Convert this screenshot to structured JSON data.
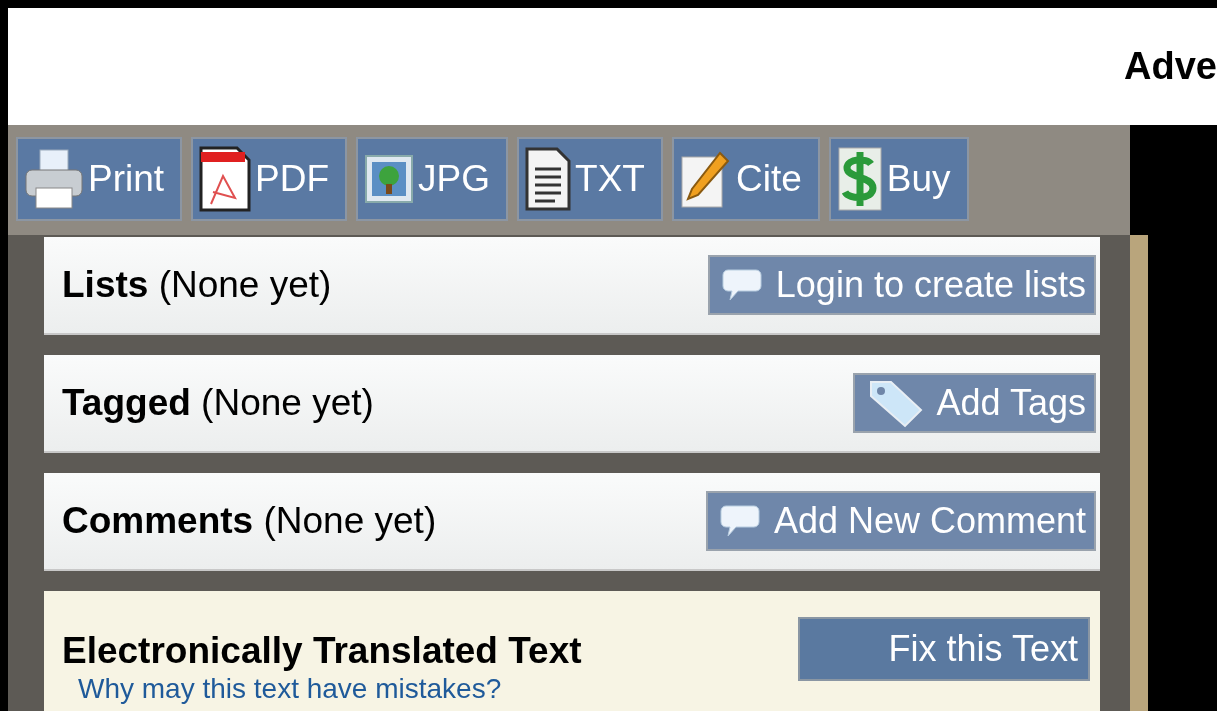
{
  "header": {
    "text": "Adve"
  },
  "toolbar": [
    {
      "label": "Print",
      "kind": "print"
    },
    {
      "label": "PDF",
      "kind": "pdf"
    },
    {
      "label": "JPG",
      "kind": "image"
    },
    {
      "label": "TXT",
      "kind": "document"
    },
    {
      "label": "Cite",
      "kind": "pencil"
    },
    {
      "label": "Buy",
      "kind": "dollar"
    }
  ],
  "sections": [
    {
      "title": "Lists",
      "note": "(None yet)",
      "button": {
        "label": "Login to create lists",
        "kind": "speech"
      }
    },
    {
      "title": "Tagged",
      "note": "(None yet)",
      "button": {
        "label": "Add Tags",
        "kind": "tag"
      }
    },
    {
      "title": "Comments",
      "note": "(None yet)",
      "button": {
        "label": "Add New Comment",
        "kind": "speech"
      }
    }
  ],
  "translation": {
    "title": "Electronically Translated Text",
    "link": "Why may this text have mistakes?",
    "button": "Fix this Text"
  }
}
